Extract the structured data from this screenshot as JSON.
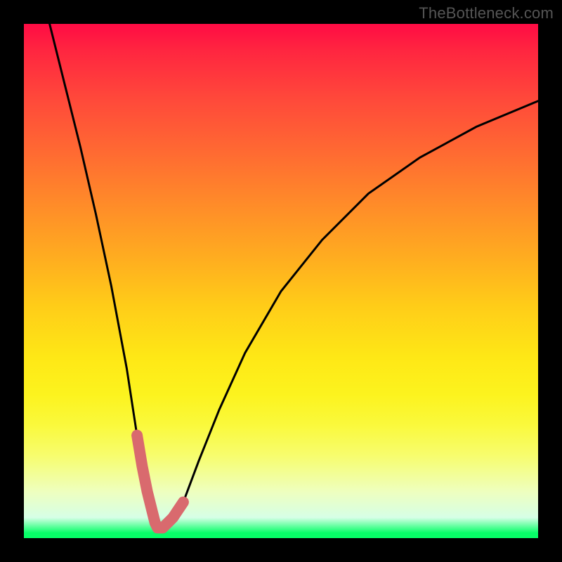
{
  "watermark": "TheBottleneck.com",
  "chart_data": {
    "type": "line",
    "title": "",
    "xlabel": "",
    "ylabel": "",
    "xlim": [
      0,
      100
    ],
    "ylim": [
      0,
      100
    ],
    "grid": false,
    "legend": false,
    "series": [
      {
        "name": "bottleneck-curve",
        "x": [
          5,
          8,
          11,
          14,
          17,
          20,
          22,
          24,
          25.5,
          27,
          29,
          31,
          34,
          38,
          43,
          50,
          58,
          67,
          77,
          88,
          100
        ],
        "values": [
          100,
          88,
          76,
          63,
          49,
          33,
          20,
          9,
          3,
          2,
          3,
          7,
          15,
          25,
          36,
          48,
          58,
          67,
          74,
          80,
          85
        ]
      },
      {
        "name": "valley-highlight",
        "x": [
          22,
          23,
          24,
          25,
          25.5,
          26,
          27,
          28,
          29,
          30,
          31
        ],
        "values": [
          20,
          14,
          9,
          5,
          3,
          2,
          2,
          3,
          4,
          5.5,
          7
        ]
      }
    ],
    "colors": {
      "curve": "#000000",
      "highlight": "#d96a6e",
      "background_top": "#ff0b44",
      "background_bottom": "#07ff68"
    },
    "annotations": []
  }
}
